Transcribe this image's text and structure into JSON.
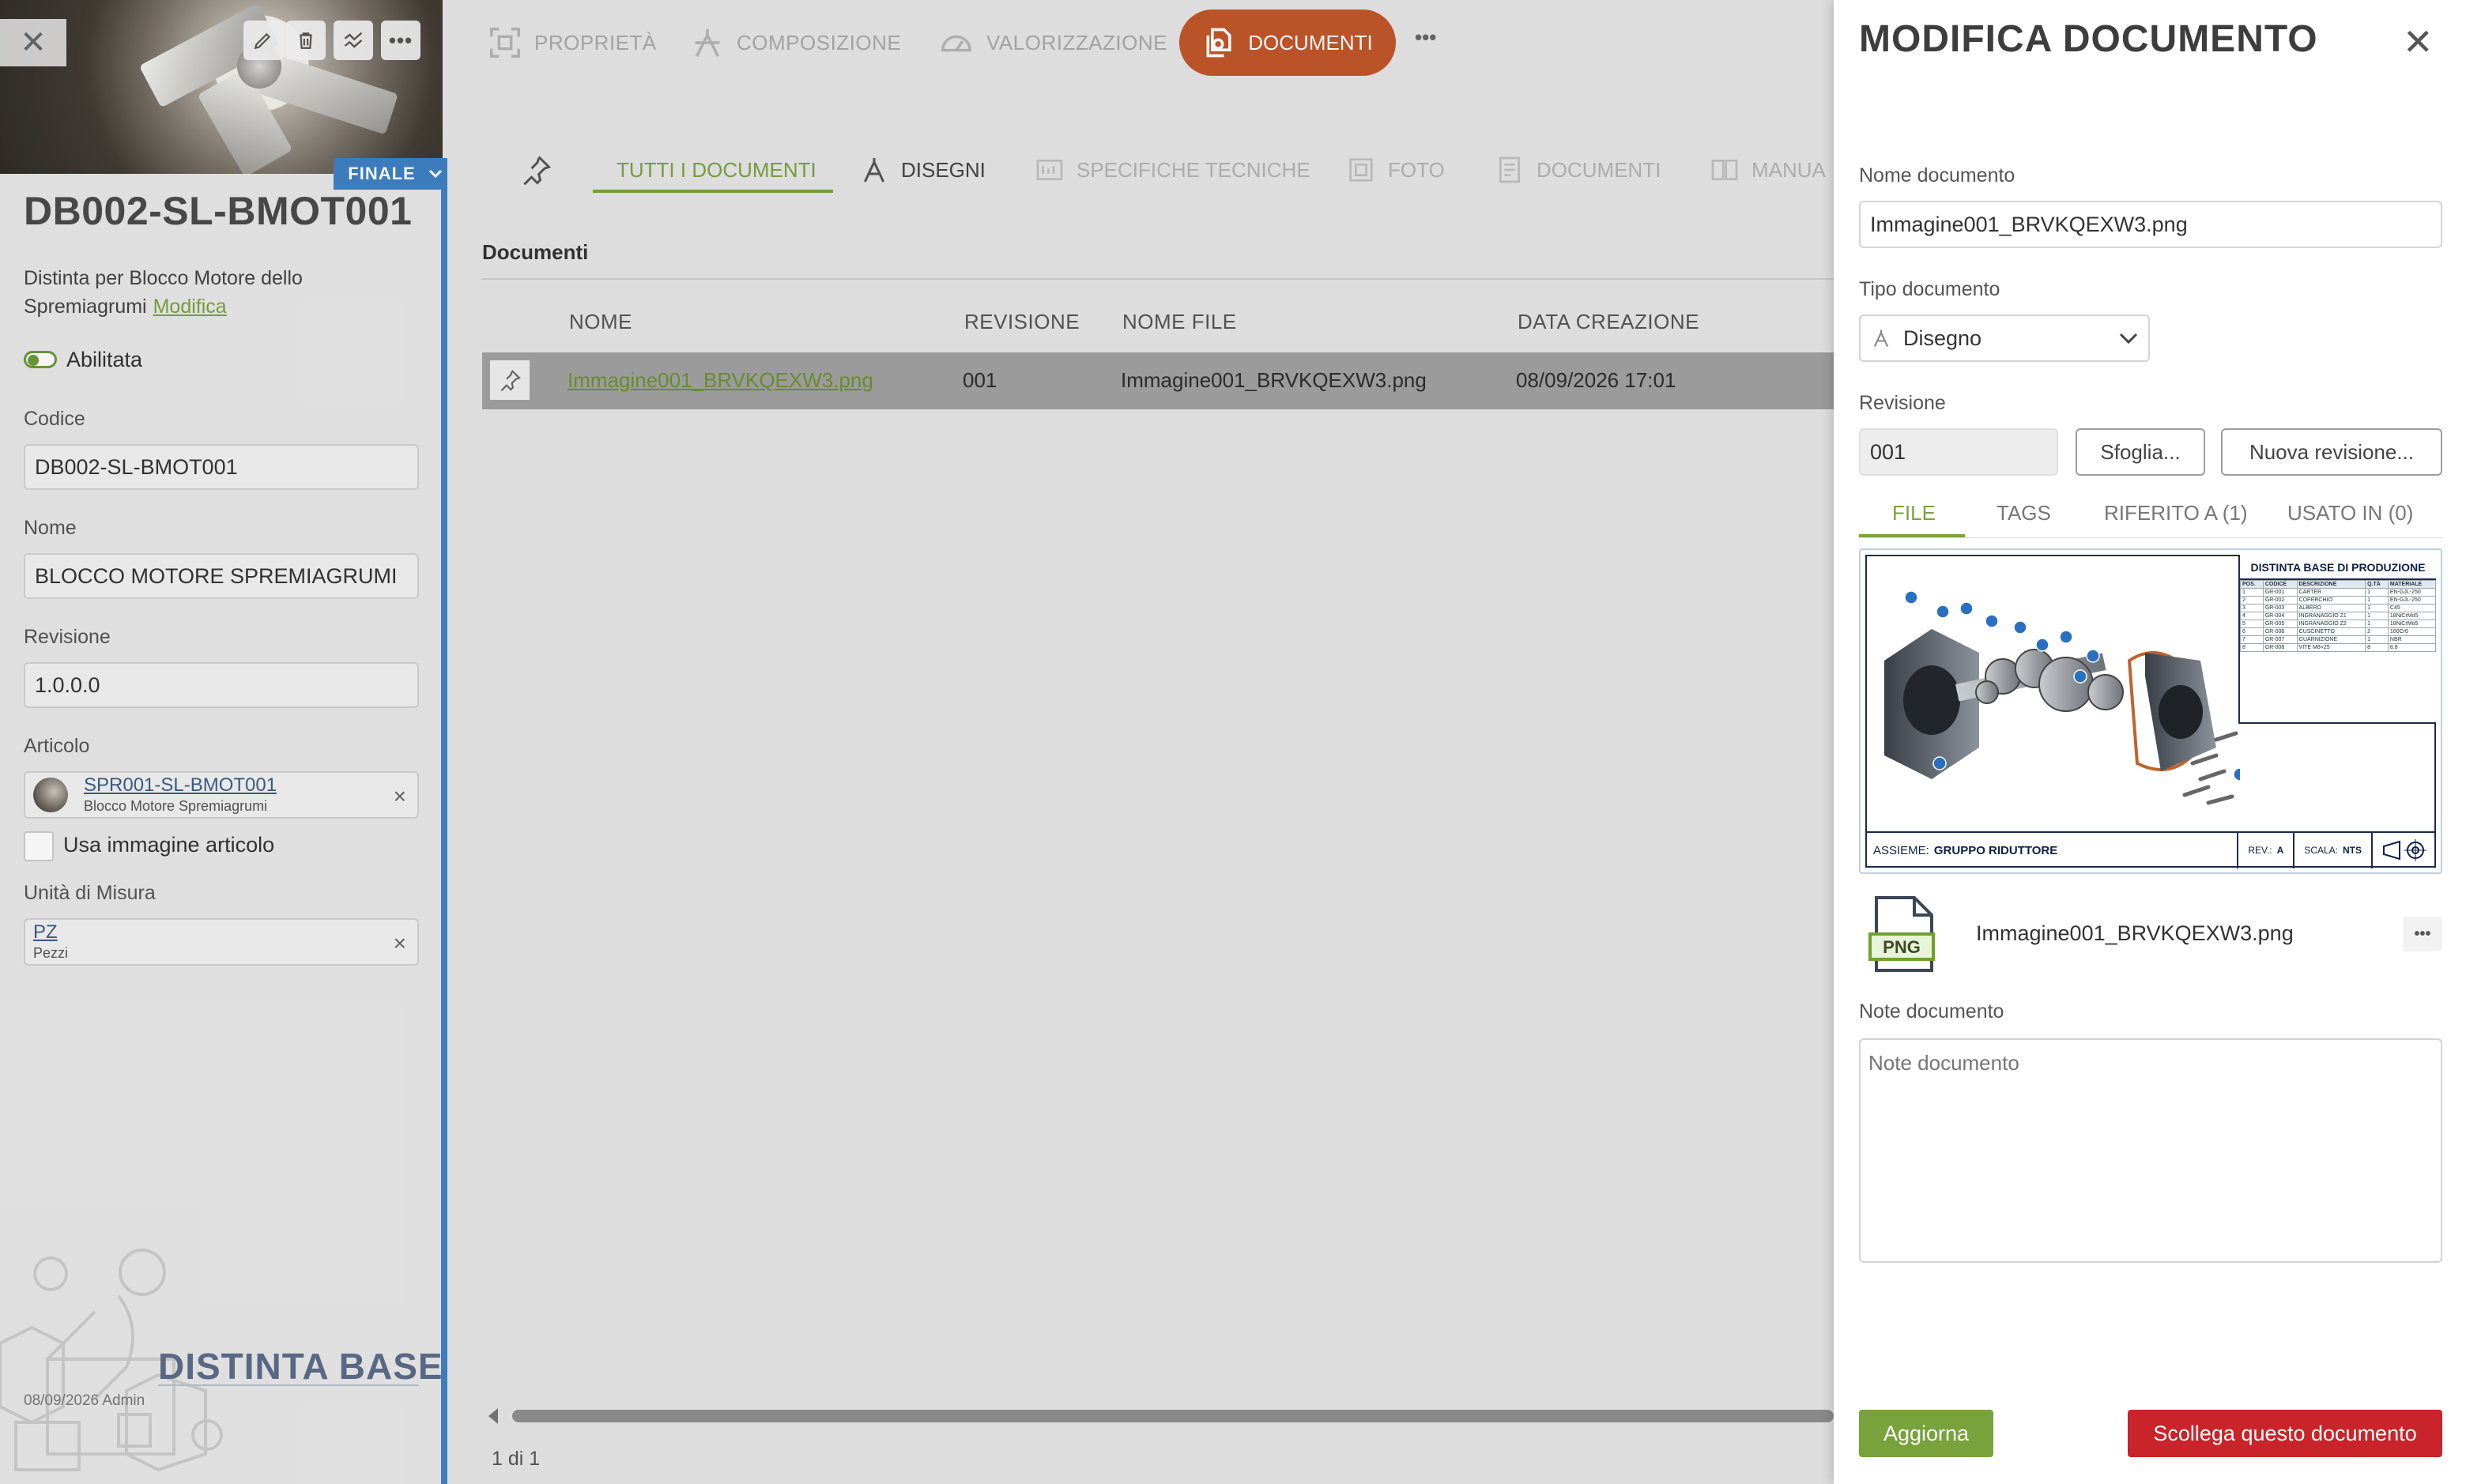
{
  "left": {
    "close_glyph": "✕",
    "badge": "FINALE",
    "title": "DB002-SL-BMOT001",
    "description": "Distinta per Blocco Motore dello Spremiagrumi",
    "modify_link": "Modifica",
    "enabled_label": "Abilitata",
    "fields": {
      "codice_label": "Codice",
      "codice_value": "DB002-SL-BMOT001",
      "nome_label": "Nome",
      "nome_value": "BLOCCO MOTORE SPREMIAGRUMI",
      "revisione_label": "Revisione",
      "revisione_value": "1.0.0.0",
      "articolo_label": "Articolo",
      "articolo_code": "SPR001-SL-BMOT001",
      "articolo_desc": "Blocco Motore Spremiagrumi",
      "usa_immagine_label": "Usa immagine articolo",
      "um_label": "Unità di Misura",
      "um_code": "PZ",
      "um_desc": "Pezzi"
    },
    "module_label": "DISTINTA BASE",
    "footer_meta": "08/09/2026 Admin"
  },
  "nav": {
    "proprieta": "PROPRIETÀ",
    "composizione": "COMPOSIZIONE",
    "valorizzazione": "VALORIZZAZIONE",
    "documenti": "DOCUMENTI",
    "more": "•••"
  },
  "subtabs": {
    "tutti": "TUTTI I DOCUMENTI",
    "disegni": "DISEGNI",
    "specifiche": "SPECIFICHE TECNICHE",
    "foto": "FOTO",
    "documenti": "DOCUMENTI",
    "manuali": "MANUA"
  },
  "documents": {
    "section_title": "Documenti",
    "columns": [
      "NOME",
      "REVISIONE",
      "NOME FILE",
      "DATA CREAZIONE"
    ],
    "rows": [
      {
        "nome": "Immagine001_BRVKQEXW3.png",
        "revisione": "001",
        "nome_file": "Immagine001_BRVKQEXW3.png",
        "data": "08/09/2026 17:01"
      }
    ],
    "pager": "1 di 1"
  },
  "editor": {
    "title": "MODIFICA DOCUMENTO",
    "close_glyph": "✕",
    "nome_label": "Nome documento",
    "nome_value": "Immagine001_BRVKQEXW3.png",
    "tipo_label": "Tipo documento",
    "tipo_value": "Disegno",
    "revisione_label": "Revisione",
    "revisione_value": "001",
    "browse_button": "Sfoglia...",
    "new_revision_button": "Nuova revisione...",
    "tabs": [
      "FILE",
      "TAGS",
      "RIFERITO A (1)",
      "USATO IN (0)"
    ],
    "file_type": "PNG",
    "file_name": "Immagine001_BRVKQEXW3.png",
    "more_glyph": "•••",
    "note_label": "Note documento",
    "note_placeholder": "Note documento",
    "update_button": "Aggiorna",
    "unlink_button": "Scollega questo documento"
  },
  "preview": {
    "bom_title": "DISTINTA BASE DI PRODUZIONE",
    "bom_columns": [
      "POS.",
      "CODICE",
      "DESCRIZIONE",
      "Q.TÀ",
      "MATERIALE"
    ],
    "bom_rows": [
      [
        "1",
        "GR-001",
        "CARTER",
        "1",
        "EN-GJL-250"
      ],
      [
        "2",
        "GR-002",
        "COPERCHIO",
        "1",
        "EN-GJL-250"
      ],
      [
        "3",
        "GR-003",
        "ALBERO",
        "1",
        "C45"
      ],
      [
        "4",
        "GR-004",
        "INGRANAGGIO Z1",
        "1",
        "18NiCrMo5"
      ],
      [
        "5",
        "GR-005",
        "INGRANAGGIO Z2",
        "1",
        "18NiCrMo5"
      ],
      [
        "6",
        "GR-006",
        "CUSCINETTO",
        "2",
        "100Cr6"
      ],
      [
        "7",
        "GR-007",
        "GUARNIZIONE",
        "1",
        "NBR"
      ],
      [
        "8",
        "GR-008",
        "VITE M8×25",
        "8",
        "8.8"
      ]
    ],
    "assieme_label": "ASSIEME:",
    "assieme_value": "GRUPPO RIDUTTORE",
    "rev_label": "REV.:",
    "rev_value": "A",
    "scala_label": "SCALA:",
    "scala_value": "NTS"
  },
  "colors": {
    "accent_green": "#7ba23f",
    "brand_orange": "#c2572a",
    "danger_red": "#c8242a",
    "blue": "#3f82c4"
  }
}
